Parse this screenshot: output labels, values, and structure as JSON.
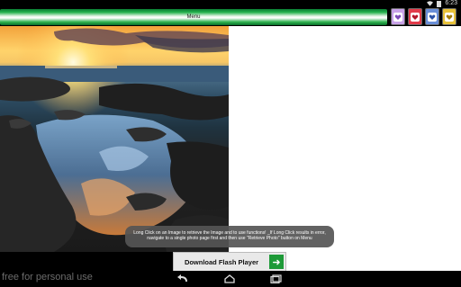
{
  "status_bar": {
    "time": "6:23",
    "icons": [
      "wifi-icon",
      "battery-icon"
    ]
  },
  "menu": {
    "label": "Menu"
  },
  "app_icons": [
    {
      "name": "app-icon-1",
      "color": "#c8a2e8"
    },
    {
      "name": "app-icon-2",
      "color": "#e23b4a"
    },
    {
      "name": "app-icon-3",
      "color": "#6a8fd8"
    },
    {
      "name": "app-icon-4",
      "color": "#e8c23a"
    }
  ],
  "photo": {
    "subject": "sunset-over-tide-pools"
  },
  "toast": {
    "text": "Long Click on an Image to retrieve the Image and to use functions! _If Long Click results in error, navigate to a single photo page first and then use \"Retrieve Photo\" button on Menu"
  },
  "flash_banner": {
    "label": "Download Flash Player",
    "accent": "#1e9a38"
  },
  "watermark": {
    "text": "free for personal use"
  },
  "nav_bar": {
    "buttons": [
      "back-icon",
      "home-icon",
      "recent-apps-icon"
    ]
  }
}
